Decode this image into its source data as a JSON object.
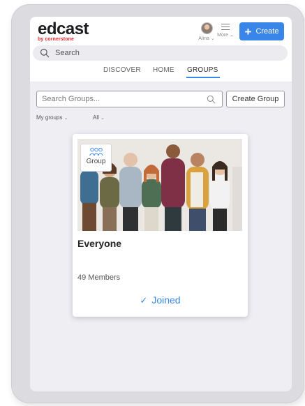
{
  "header": {
    "logo_text": "edcast",
    "logo_sub": "by cornerstone",
    "user_name": "Alina",
    "more_label": "More",
    "create_label": "Create",
    "search_placeholder": "Search"
  },
  "tabs": [
    {
      "label": "DISCOVER",
      "active": false
    },
    {
      "label": "HOME",
      "active": false
    },
    {
      "label": "GROUPS",
      "active": true
    }
  ],
  "groups_page": {
    "search_placeholder": "Search Groups...",
    "create_group_label": "Create Group",
    "filters": {
      "my_groups": "My groups",
      "all": "All"
    }
  },
  "group_card": {
    "badge_label": "Group",
    "title": "Everyone",
    "members": "49 Members",
    "status": "Joined"
  },
  "icons": {
    "accent": "#3a86e8",
    "brand_red": "#e3242b"
  }
}
